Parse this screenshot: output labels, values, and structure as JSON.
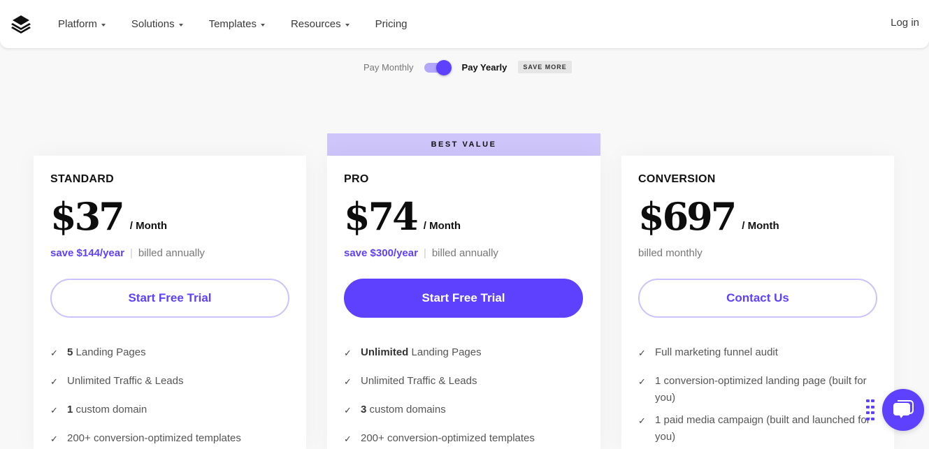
{
  "nav": {
    "logo": "layers-logo",
    "items": [
      {
        "label": "Platform",
        "dropdown": true
      },
      {
        "label": "Solutions",
        "dropdown": true
      },
      {
        "label": "Templates",
        "dropdown": true
      },
      {
        "label": "Resources",
        "dropdown": true
      },
      {
        "label": "Pricing",
        "dropdown": false
      }
    ],
    "login": "Log in"
  },
  "billing_toggle": {
    "monthly_label": "Pay Monthly",
    "yearly_label": "Pay Yearly",
    "selected": "yearly",
    "badge": "SAVE MORE"
  },
  "colors": {
    "accent": "#5d41fe",
    "accent_light": "#cec5fa",
    "background": "#f8f8f8"
  },
  "plans": [
    {
      "name": "STANDARD",
      "price": "$37",
      "period": "/ Month",
      "save": "save $144/year",
      "separator": "|",
      "billing": "billed annually",
      "cta": "Start Free Trial",
      "features": [
        {
          "bold": "5",
          "text": " Landing Pages"
        },
        {
          "bold": "",
          "text": "Unlimited Traffic & Leads"
        },
        {
          "bold": "1",
          "text": " custom domain"
        },
        {
          "bold": "",
          "text": "200+ conversion-optimized templates"
        }
      ]
    },
    {
      "badge": "BEST VALUE",
      "name": "PRO",
      "price": "$74",
      "period": "/ Month",
      "save": "save $300/year",
      "separator": "|",
      "billing": "billed annually",
      "cta": "Start Free Trial",
      "features": [
        {
          "bold": "Unlimited",
          "text": " Landing Pages"
        },
        {
          "bold": "",
          "text": "Unlimited Traffic & Leads"
        },
        {
          "bold": "3",
          "text": " custom domains"
        },
        {
          "bold": "",
          "text": "200+ conversion-optimized templates"
        }
      ]
    },
    {
      "name": "CONVERSION",
      "price": "$697",
      "period": "/ Month",
      "billing": "billed monthly",
      "cta": "Contact Us",
      "features": [
        {
          "bold": "",
          "text": "Full marketing funnel audit"
        },
        {
          "bold": "",
          "text": "1 conversion-optimized landing page (built for you)"
        },
        {
          "bold": "",
          "text": "1 paid media campaign (built and launched for you)"
        }
      ]
    }
  ],
  "chat_widget": {
    "icon": "chat-bubble-icon",
    "handle": "drag-handle-icon"
  }
}
